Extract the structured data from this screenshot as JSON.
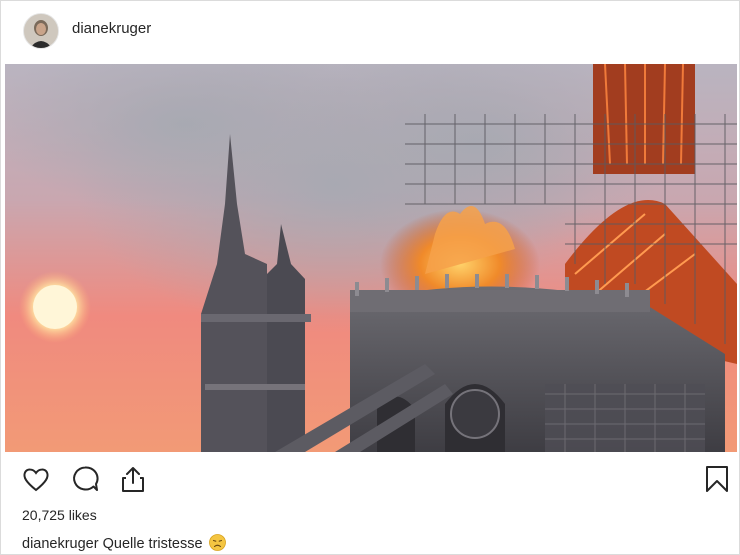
{
  "post": {
    "username": "dianekruger",
    "likes_text": "20,725 likes",
    "caption_user": "dianekruger",
    "caption_text": "Quelle tristesse",
    "caption_emoji": "disappointed-face-emoji"
  },
  "icons": {
    "like": "heart-icon",
    "comment": "comment-icon",
    "share": "share-icon",
    "save": "bookmark-icon"
  },
  "colors": {
    "text": "#262626",
    "border": "#dbdbdb",
    "emoji_yellow": "#f4c542"
  }
}
